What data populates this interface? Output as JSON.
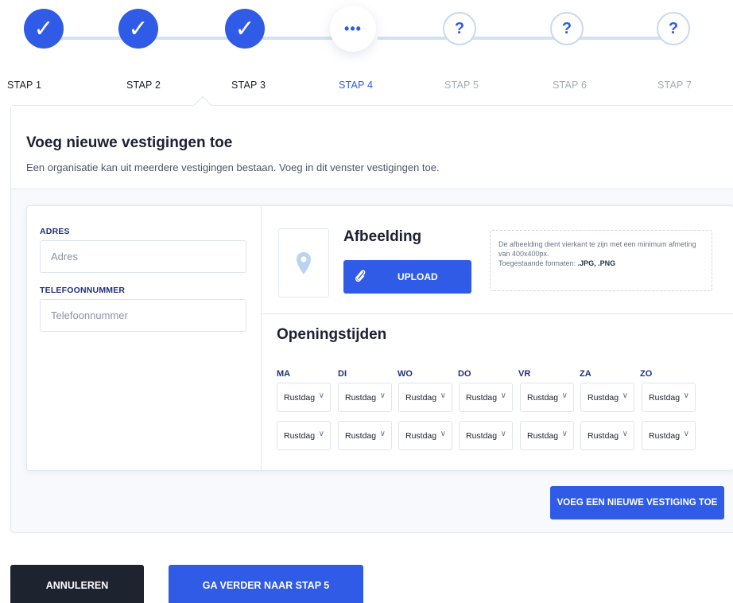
{
  "stepper": {
    "steps": [
      {
        "label": "STAP 1",
        "state": "done",
        "glyph": "✓"
      },
      {
        "label": "STAP 2",
        "state": "done",
        "glyph": "✓"
      },
      {
        "label": "STAP 3",
        "state": "done",
        "glyph": "✓"
      },
      {
        "label": "STAP 4",
        "state": "current",
        "glyph": "•••"
      },
      {
        "label": "STAP 5",
        "state": "todo",
        "glyph": "?"
      },
      {
        "label": "STAP 6",
        "state": "todo",
        "glyph": "?"
      },
      {
        "label": "STAP 7",
        "state": "todo",
        "glyph": "?"
      }
    ]
  },
  "header": {
    "title": "Voeg nieuwe vestigingen toe",
    "subtitle": "Een organisatie kan uit meerdere vestigingen bestaan. Voeg in dit venster vestigingen toe."
  },
  "form": {
    "address_label": "ADRES",
    "address_placeholder": "Adres",
    "phone_label": "TELEFOONNUMMER",
    "phone_placeholder": "Telefoonnummer"
  },
  "image": {
    "heading": "Afbeelding",
    "upload_label": "UPLOAD",
    "hint_line1": "De afbeelding dient vierkant te zijn met een minimum afmeting van 400x400px.",
    "hint_prefix": "Toegestaande formaten: ",
    "hint_formats": ".JPG, .PNG"
  },
  "hours": {
    "heading": "Openingstijden",
    "days": [
      "MA",
      "DI",
      "WO",
      "DO",
      "VR",
      "ZA",
      "ZO"
    ],
    "rows": [
      [
        "Rustdag",
        "Rustdag",
        "Rustdag",
        "Rustdag",
        "Rustdag",
        "Rustdag",
        "Rustdag"
      ],
      [
        "Rustdag",
        "Rustdag",
        "Rustdag",
        "Rustdag",
        "Rustdag",
        "Rustdag",
        "Rustdag"
      ]
    ]
  },
  "actions": {
    "add_location": "VOEG EEN NIEUWE VESTIGING TOE",
    "cancel": "ANNULEREN",
    "next": "GA VERDER NAAR STAP 5"
  },
  "colors": {
    "primary": "#2f5be7",
    "dark": "#1e2330",
    "label": "#22317a"
  }
}
